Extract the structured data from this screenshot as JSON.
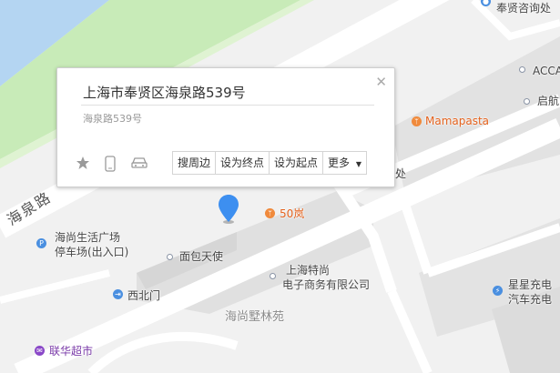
{
  "popup": {
    "title": "上海市奉贤区海泉路539号",
    "subtitle": "海泉路539号",
    "actions": [
      "搜周边",
      "设为终点",
      "设为起点",
      "更多"
    ],
    "more_caret": "▼",
    "close_glyph": "✕"
  },
  "map": {
    "road_name": "海泉路",
    "labels": {
      "top_right_1": "奉贤咨询处",
      "accai": "ACCAI",
      "qibei": "启航",
      "mamapasta": "Mamapasta",
      "chu": "处",
      "wu_lan": "50岚",
      "haishang_parking_1": "海尚生活广场",
      "haishang_parking_2": "停车场(出入口)",
      "bread": "面包天使",
      "xibeimen": "西北门",
      "shangshang_1": "上海特尚",
      "shangshang_2": "电子商务有限公司",
      "haishang_lin": "海尚墅林苑",
      "xingxing_1": "星星充电",
      "xingxing_2": "汽车充电",
      "lianhua": "联华超市"
    },
    "colors": {
      "water": "#b4d5f2",
      "park": "#c8ebb8",
      "building": "#e3e3e3",
      "road": "#ffffff",
      "marker": "#3d8ff0",
      "poi_orange": "#f08a3c",
      "poi_blue": "#4a8fe0",
      "poi_purple": "#8a48c8"
    }
  }
}
